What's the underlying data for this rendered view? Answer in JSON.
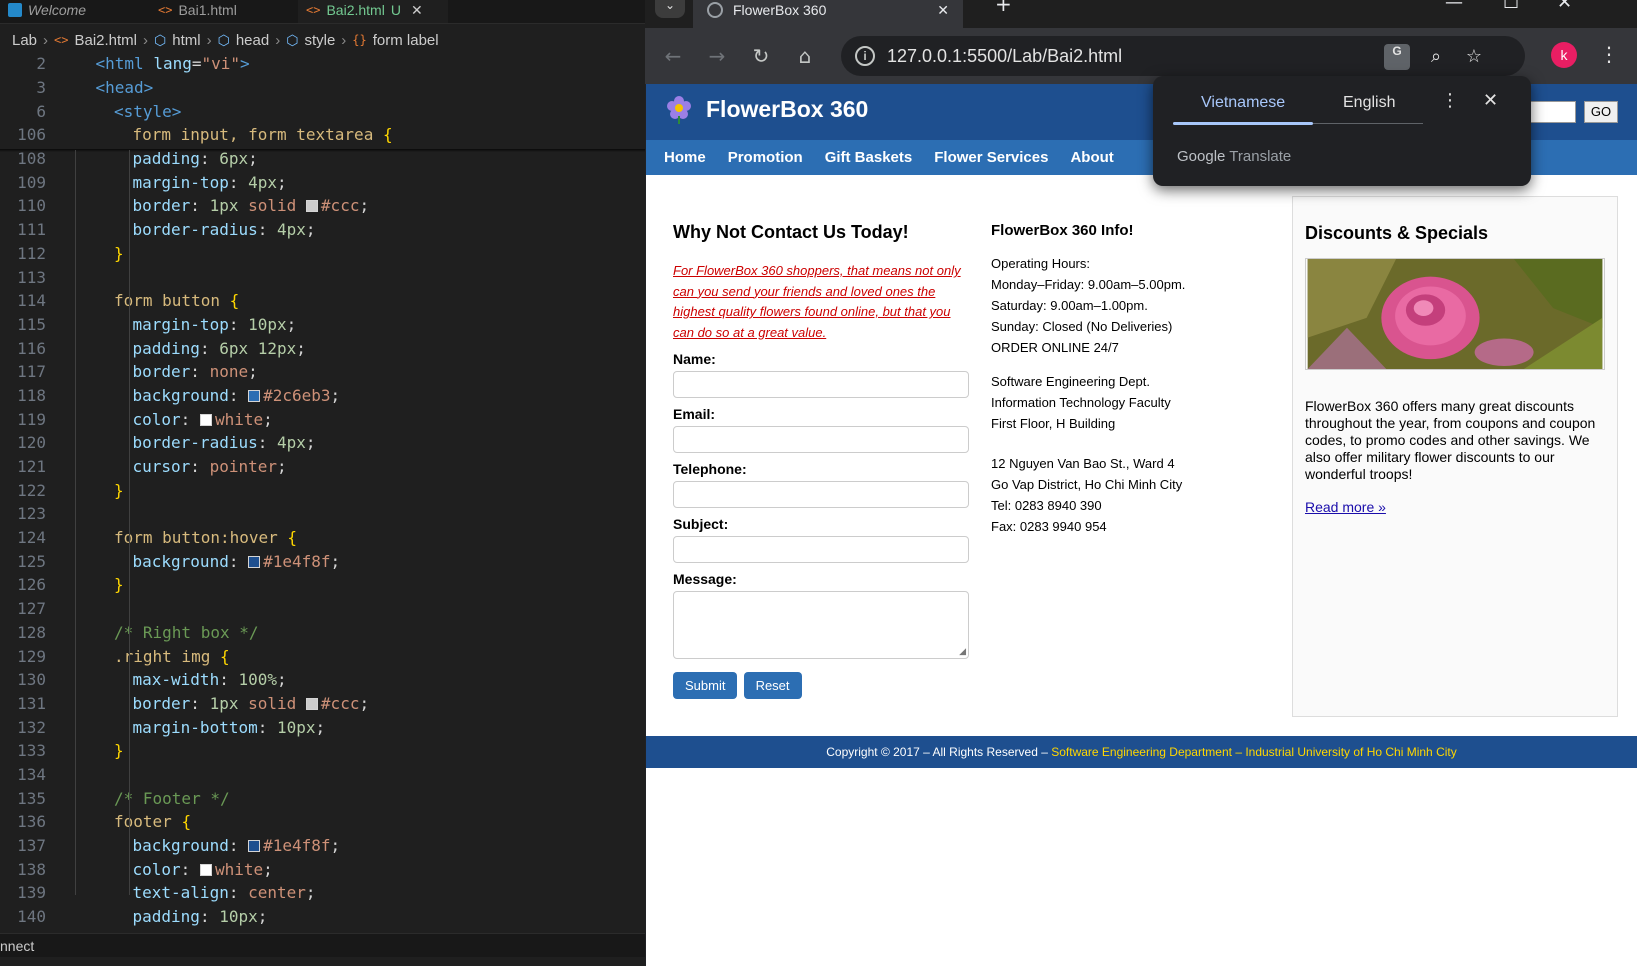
{
  "editor": {
    "tabs": [
      {
        "label": "Welcome"
      },
      {
        "label": "Bai1.html"
      },
      {
        "label": "Bai2.html",
        "badge": "U"
      }
    ],
    "breadcrumb": [
      "Lab",
      "Bai2.html",
      "html",
      "head",
      "style",
      "form label"
    ],
    "sticky_lines": [
      {
        "no": "2",
        "code": "<html lang=\"vi\">"
      },
      {
        "no": "3",
        "code": "<head>"
      },
      {
        "no": "6",
        "code": "<style>"
      },
      {
        "no": "106",
        "code": "form input, form textarea {"
      }
    ],
    "lines": [
      {
        "no": "108",
        "code": "padding: 6px;"
      },
      {
        "no": "109",
        "code": "margin-top: 4px;"
      },
      {
        "no": "110",
        "code": "border: 1px solid #ccc;"
      },
      {
        "no": "111",
        "code": "border-radius: 4px;"
      },
      {
        "no": "112",
        "code": "}"
      },
      {
        "no": "113",
        "code": ""
      },
      {
        "no": "114",
        "code": "form button {"
      },
      {
        "no": "115",
        "code": "margin-top: 10px;"
      },
      {
        "no": "116",
        "code": "padding: 6px 12px;"
      },
      {
        "no": "117",
        "code": "border: none;"
      },
      {
        "no": "118",
        "code": "background: #2c6eb3;"
      },
      {
        "no": "119",
        "code": "color: white;"
      },
      {
        "no": "120",
        "code": "border-radius: 4px;"
      },
      {
        "no": "121",
        "code": "cursor: pointer;"
      },
      {
        "no": "122",
        "code": "}"
      },
      {
        "no": "123",
        "code": ""
      },
      {
        "no": "124",
        "code": "form button:hover {"
      },
      {
        "no": "125",
        "code": "background: #1e4f8f;"
      },
      {
        "no": "126",
        "code": "}"
      },
      {
        "no": "127",
        "code": ""
      },
      {
        "no": "128",
        "code": "/* Right box */"
      },
      {
        "no": "129",
        "code": ".right img {"
      },
      {
        "no": "130",
        "code": "max-width: 100%;"
      },
      {
        "no": "131",
        "code": "border: 1px solid #ccc;"
      },
      {
        "no": "132",
        "code": "margin-bottom: 10px;"
      },
      {
        "no": "133",
        "code": "}"
      },
      {
        "no": "134",
        "code": ""
      },
      {
        "no": "135",
        "code": "/* Footer */"
      },
      {
        "no": "136",
        "code": "footer {"
      },
      {
        "no": "137",
        "code": "background: #1e4f8f;"
      },
      {
        "no": "138",
        "code": "color: white;"
      },
      {
        "no": "139",
        "code": "text-align: center;"
      },
      {
        "no": "140",
        "code": "padding: 10px;"
      }
    ],
    "status_text": "nnect"
  },
  "browser": {
    "tab_title": "FlowerBox 360",
    "url": "127.0.0.1:5500/Lab/Bai2.html",
    "profile_initial": "k",
    "translate": {
      "lang_from": "Vietnamese",
      "lang_to": "English",
      "brand_google": "Google",
      "brand_translate": "Translate"
    }
  },
  "site": {
    "title": "FlowerBox 360",
    "search_button": "GO",
    "nav": [
      "Home",
      "Promotion",
      "Gift Baskets",
      "Flower Services",
      "About"
    ],
    "contact": {
      "title": "Why Not Contact Us Today!",
      "intro": "For FlowerBox 360 shoppers, that means not only can you send your friends and loved ones the highest quality flowers found online, but that you can do so at a great value.",
      "fields": [
        "Name:",
        "Email:",
        "Telephone:",
        "Subject:",
        "Message:"
      ],
      "submit": "Submit",
      "reset": "Reset"
    },
    "info": {
      "title": "FlowerBox 360 Info!",
      "hours": [
        "Operating Hours:",
        "Monday–Friday: 9.00am–5.00pm.",
        "Saturday: 9.00am–1.00pm.",
        "Sunday: Closed (No Deliveries)",
        "ORDER ONLINE 24/7"
      ],
      "dept": [
        "Software Engineering Dept.",
        "Information Technology Faculty",
        "First Floor, H Building"
      ],
      "address": [
        "12 Nguyen Van Bao St., Ward 4",
        "Go Vap District, Ho Chi Minh City",
        "Tel: 0283 8940 390",
        "Fax: 0283 9940 954"
      ]
    },
    "specials": {
      "title": "Discounts & Specials",
      "text": "FlowerBox 360 offers many great discounts throughout the year, from coupons and coupon codes, to promo codes and other savings. We also offer military flower discounts to our wonderful troops!",
      "link": "Read more »"
    },
    "footer": {
      "prefix": "Copyright © 2017 – All Rights Reserved – ",
      "highlight": "Software Engineering Department – Industrial University of Ho Chi Minh City"
    }
  }
}
